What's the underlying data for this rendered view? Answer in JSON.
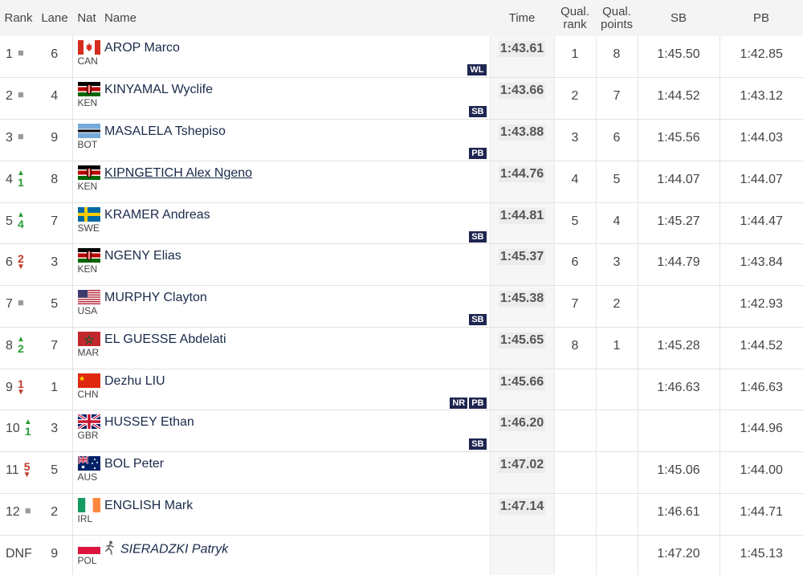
{
  "headers": {
    "rank": "Rank",
    "lane": "Lane",
    "nat": "Nat",
    "name": "Name",
    "time": "Time",
    "qual_rank": [
      "Qual.",
      "rank"
    ],
    "qual_points": [
      "Qual.",
      "points"
    ],
    "sb": "SB",
    "pb": "PB"
  },
  "rows": [
    {
      "rank": "1",
      "move": {
        "dir": "same",
        "n": ""
      },
      "lane": "6",
      "nat": "CAN",
      "flag": "CAN",
      "name": "AROP Marco",
      "name_style": "",
      "time": "1:43.61",
      "qrank": "1",
      "qpoints": "8",
      "sb": "1:45.50",
      "pb": "1:42.85",
      "badges": [
        "WL"
      ]
    },
    {
      "rank": "2",
      "move": {
        "dir": "same",
        "n": ""
      },
      "lane": "4",
      "nat": "KEN",
      "flag": "KEN",
      "name": "KINYAMAL Wyclife",
      "name_style": "",
      "time": "1:43.66",
      "qrank": "2",
      "qpoints": "7",
      "sb": "1:44.52",
      "pb": "1:43.12",
      "badges": [
        "SB"
      ]
    },
    {
      "rank": "3",
      "move": {
        "dir": "same",
        "n": ""
      },
      "lane": "9",
      "nat": "BOT",
      "flag": "BOT",
      "name": "MASALELA Tshepiso",
      "name_style": "",
      "time": "1:43.88",
      "qrank": "3",
      "qpoints": "6",
      "sb": "1:45.56",
      "pb": "1:44.03",
      "badges": [
        "PB"
      ]
    },
    {
      "rank": "4",
      "move": {
        "dir": "up",
        "n": "1"
      },
      "lane": "8",
      "nat": "KEN",
      "flag": "KEN",
      "name": "KIPNGETICH Alex Ngeno",
      "name_style": "link",
      "time": "1:44.76",
      "qrank": "4",
      "qpoints": "5",
      "sb": "1:44.07",
      "pb": "1:44.07",
      "badges": []
    },
    {
      "rank": "5",
      "move": {
        "dir": "up",
        "n": "4"
      },
      "lane": "7",
      "nat": "SWE",
      "flag": "SWE",
      "name": "KRAMER Andreas",
      "name_style": "",
      "time": "1:44.81",
      "qrank": "5",
      "qpoints": "4",
      "sb": "1:45.27",
      "pb": "1:44.47",
      "badges": [
        "SB"
      ]
    },
    {
      "rank": "6",
      "move": {
        "dir": "down",
        "n": "2"
      },
      "lane": "3",
      "nat": "KEN",
      "flag": "KEN",
      "name": "NGENY Elias",
      "name_style": "",
      "time": "1:45.37",
      "qrank": "6",
      "qpoints": "3",
      "sb": "1:44.79",
      "pb": "1:43.84",
      "badges": []
    },
    {
      "rank": "7",
      "move": {
        "dir": "same",
        "n": ""
      },
      "lane": "5",
      "nat": "USA",
      "flag": "USA",
      "name": "MURPHY Clayton",
      "name_style": "",
      "time": "1:45.38",
      "qrank": "7",
      "qpoints": "2",
      "sb": "",
      "pb": "1:42.93",
      "badges": [
        "SB"
      ]
    },
    {
      "rank": "8",
      "move": {
        "dir": "up",
        "n": "2"
      },
      "lane": "7",
      "nat": "MAR",
      "flag": "MAR",
      "name": "EL GUESSE Abdelati",
      "name_style": "",
      "time": "1:45.65",
      "qrank": "8",
      "qpoints": "1",
      "sb": "1:45.28",
      "pb": "1:44.52",
      "badges": []
    },
    {
      "rank": "9",
      "move": {
        "dir": "down",
        "n": "1"
      },
      "lane": "1",
      "nat": "CHN",
      "flag": "CHN",
      "name": "Dezhu LIU",
      "name_style": "",
      "time": "1:45.66",
      "qrank": "",
      "qpoints": "",
      "sb": "1:46.63",
      "pb": "1:46.63",
      "badges": [
        "NR",
        "PB"
      ]
    },
    {
      "rank": "10",
      "move": {
        "dir": "up",
        "n": "1"
      },
      "lane": "3",
      "nat": "GBR",
      "flag": "GBR",
      "name": "HUSSEY Ethan",
      "name_style": "",
      "time": "1:46.20",
      "qrank": "",
      "qpoints": "",
      "sb": "",
      "pb": "1:44.96",
      "badges": [
        "SB"
      ]
    },
    {
      "rank": "11",
      "move": {
        "dir": "down",
        "n": "5"
      },
      "lane": "5",
      "nat": "AUS",
      "flag": "AUS",
      "name": "BOL Peter",
      "name_style": "",
      "time": "1:47.02",
      "qrank": "",
      "qpoints": "",
      "sb": "1:45.06",
      "pb": "1:44.00",
      "badges": []
    },
    {
      "rank": "12",
      "move": {
        "dir": "same",
        "n": ""
      },
      "lane": "2",
      "nat": "IRL",
      "flag": "IRL",
      "name": "ENGLISH Mark",
      "name_style": "",
      "time": "1:47.14",
      "qrank": "",
      "qpoints": "",
      "sb": "1:46.61",
      "pb": "1:44.71",
      "badges": []
    },
    {
      "rank": "DNF",
      "move": {
        "dir": "none",
        "n": ""
      },
      "lane": "9",
      "nat": "POL",
      "flag": "POL",
      "name": "SIERADZKI Patryk",
      "name_style": "ital",
      "icon": "runner-icon",
      "time": "",
      "qrank": "",
      "qpoints": "",
      "sb": "1:47.20",
      "pb": "1:45.13",
      "badges": []
    }
  ],
  "colors": {
    "badge": "#1e2650",
    "up": "#2a9d3a",
    "down": "#c0392b",
    "same": "#9a9a9a",
    "name": "#1a2a4a"
  }
}
